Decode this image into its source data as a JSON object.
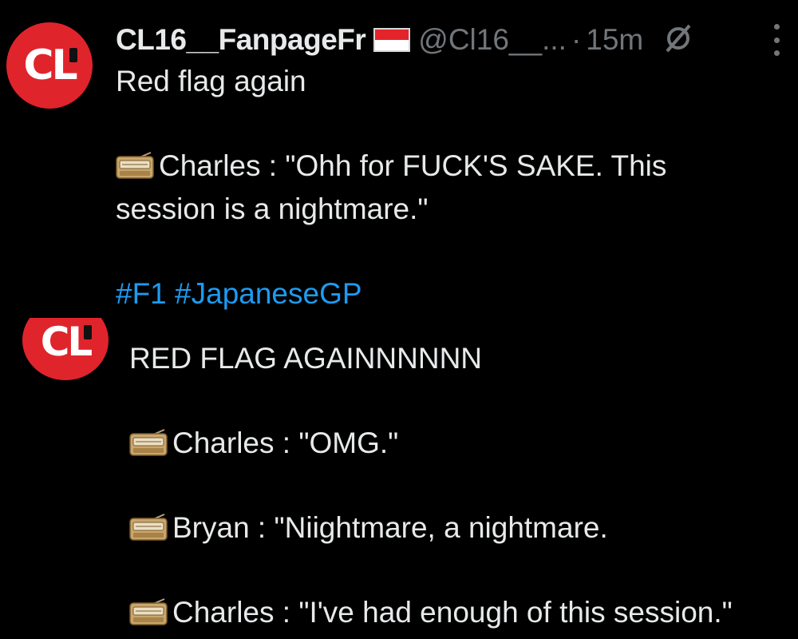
{
  "tweets": [
    {
      "name": "CL16__FanpageFr",
      "handle": "@Cl16__...",
      "separator": "·",
      "time": "15m",
      "avatar_text": "CL",
      "lines": {
        "l1": "Red flag again",
        "l2": "Charles : \"Ohh for FUCK'S SAKE. This session is a nightmare.\"",
        "hashtags": "#F1 #JapaneseGP"
      }
    },
    {
      "avatar_text": "CL",
      "lines": {
        "l1": "RED FLAG AGAINNNNNN",
        "l2": "Charles : \"OMG.\"",
        "l3": "Bryan : \"Niightmare, a nightmare.",
        "l4": "Charles : \"I've had enough of this session.\""
      }
    }
  ],
  "icons": {
    "flag": "indonesia-flag-icon",
    "grok": "grok-icon",
    "more": "more-vertical-icon",
    "radio": "radio-icon"
  },
  "colors": {
    "background": "#000000",
    "text": "#e7e9ea",
    "muted": "#71767b",
    "link": "#1d9bf0",
    "avatar": "#e0242c"
  }
}
